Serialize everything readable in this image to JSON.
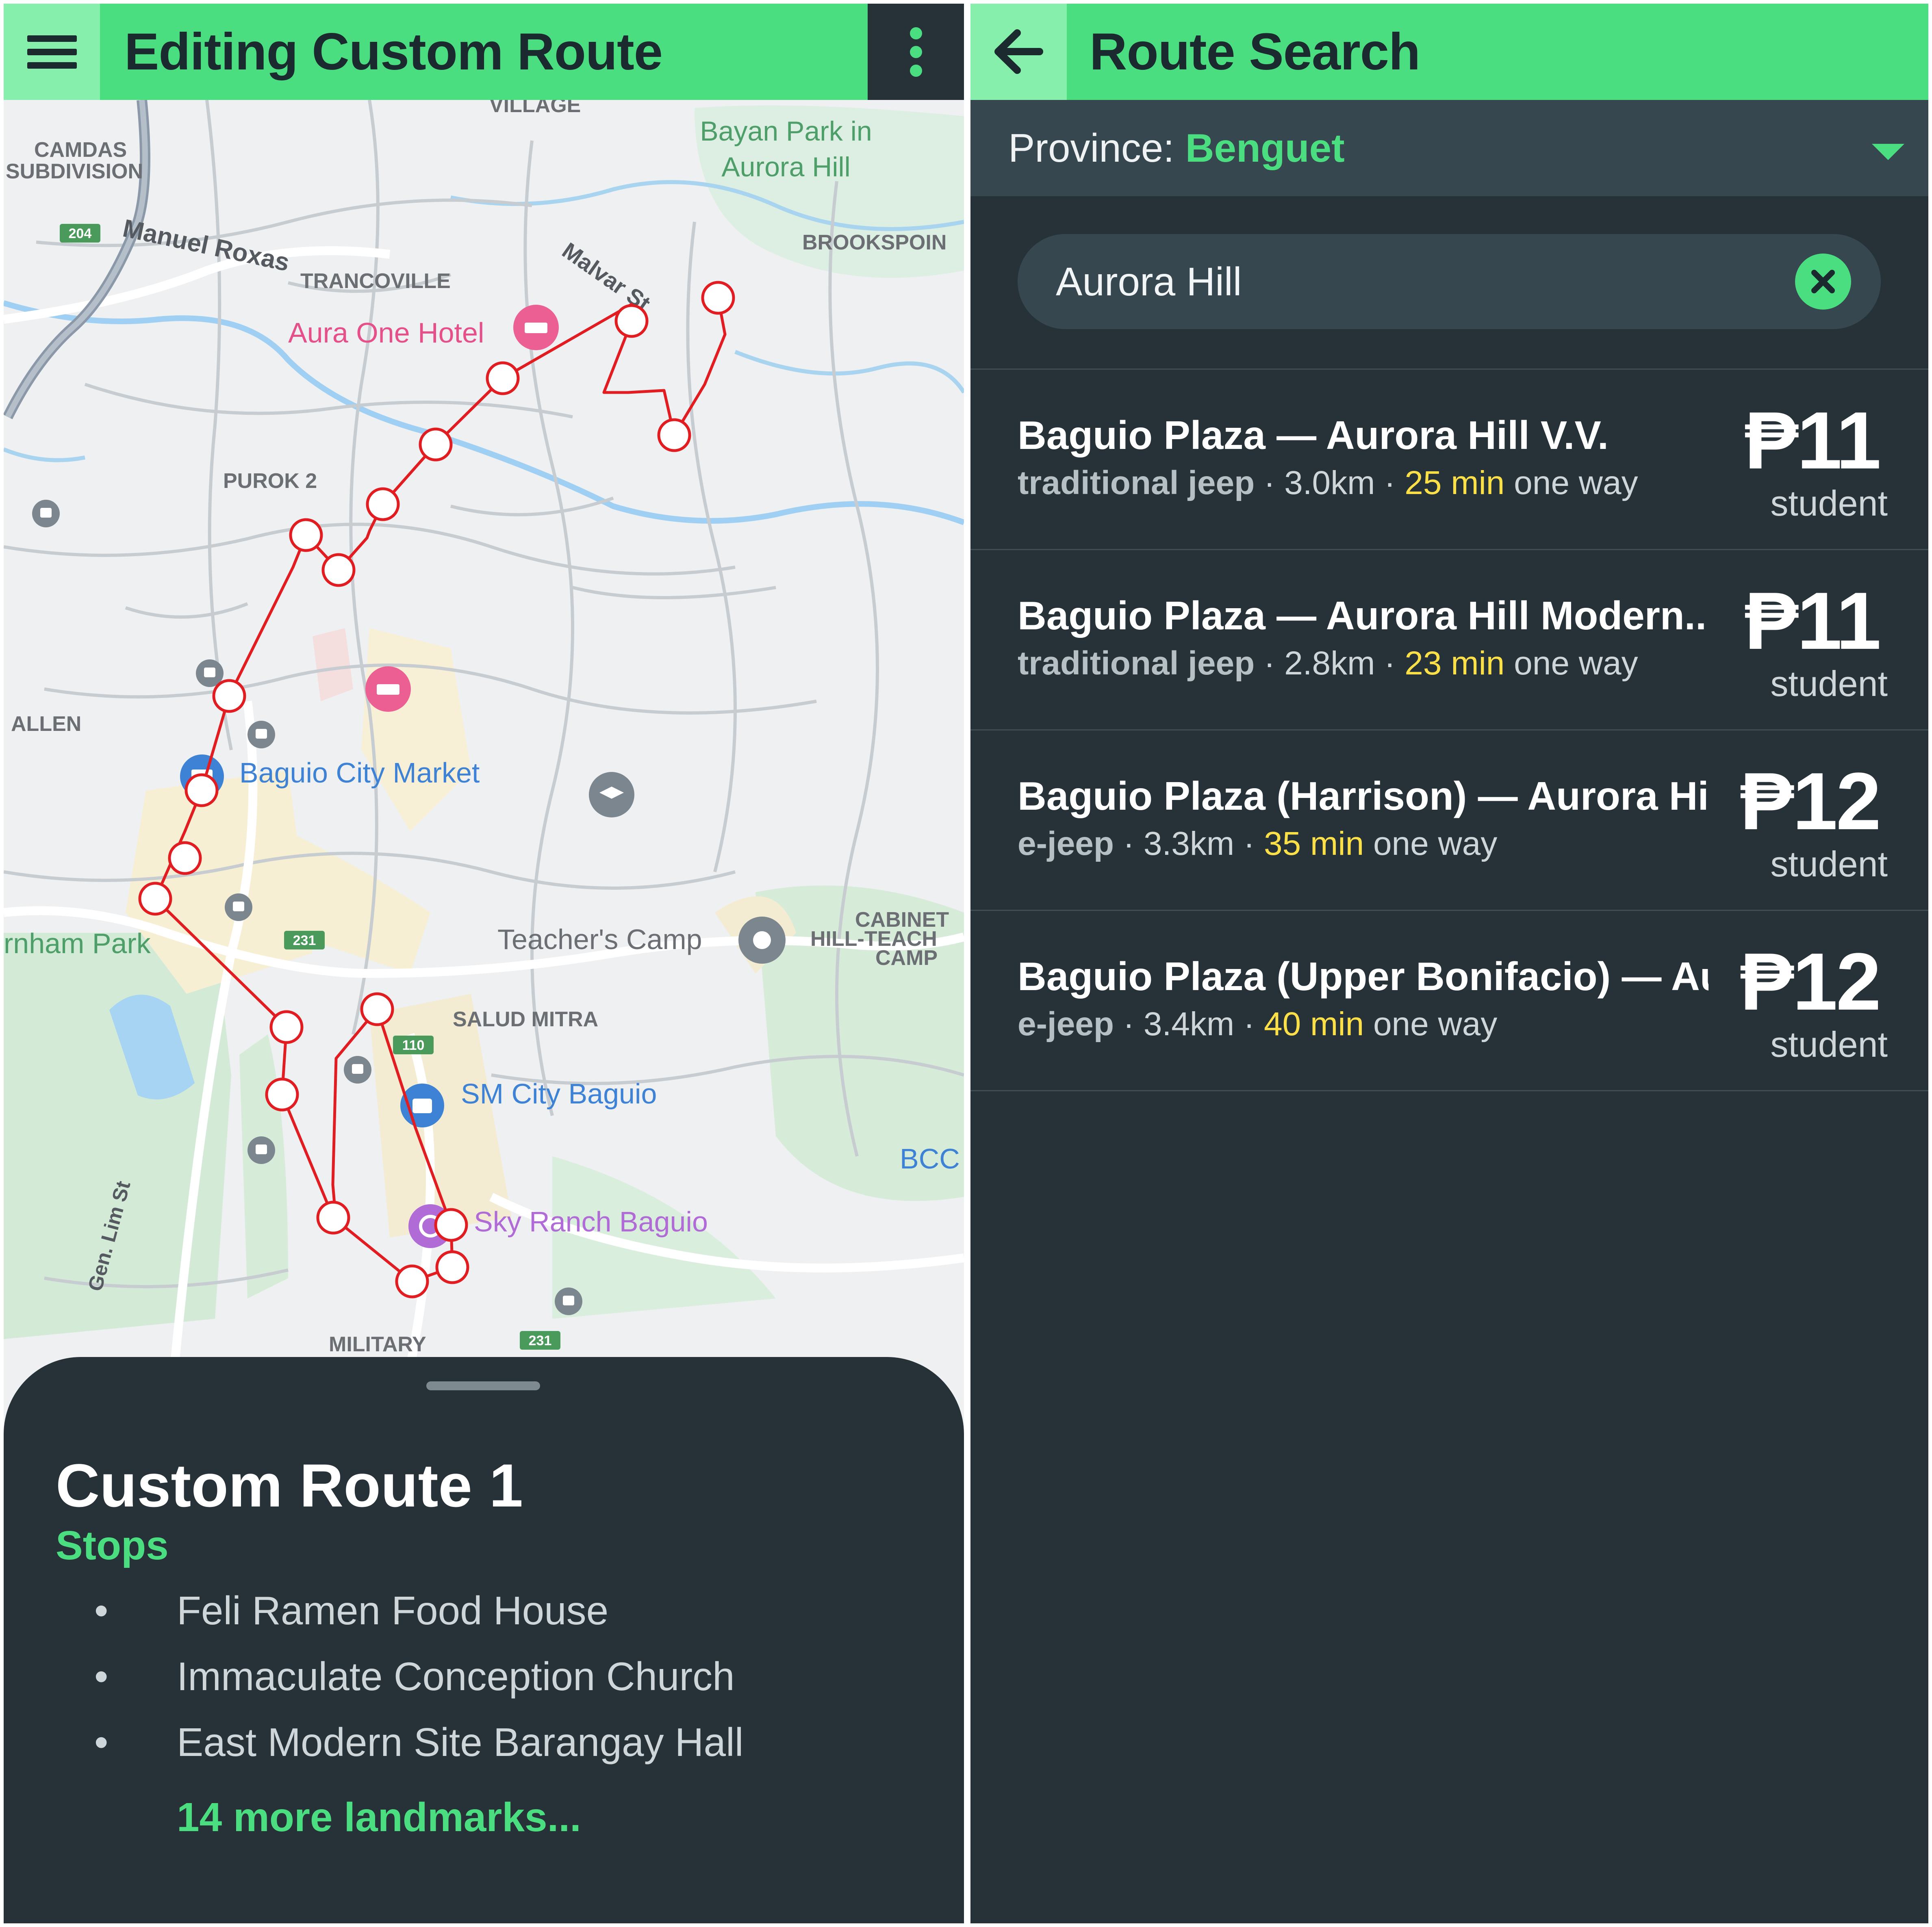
{
  "left_screen": {
    "app_bar": {
      "title": "Editing Custom Route",
      "menu_icon": "hamburger-menu-icon",
      "overflow_icon": "more-vertical-icon",
      "accent_color": "#4ade80"
    },
    "map": {
      "labels": {
        "village": "VILLAGE",
        "camdas": "CAMDAS",
        "subdivision": "SUBDIVISION",
        "bayan_park_line1": "Bayan Park in",
        "bayan_park_line2": "Aurora Hill",
        "manuel_roxas": "Manuel Roxas",
        "malvar": "Malvar St",
        "brookspoint": "BROOKSPOIN",
        "trancoville": "TRANCOVILLE",
        "aura_one_hotel": "Aura One Hotel",
        "purok2": "PUROK 2",
        "allen": "ALLEN",
        "baguio_city_market": "Baguio City Market",
        "burnham_park": "rnham Park",
        "teachers_camp": "Teacher's Camp",
        "cabinet_line1": "CABINET",
        "cabinet_line2": "HILL-TEACH",
        "cabinet_line3": "CAMP",
        "salud_mitra": "SALUD MITRA",
        "sm_city_baguio": "SM City Baguio",
        "bcc": "BCC",
        "sky_ranch": "Sky Ranch Baguio",
        "gen_lim_st": "Gen. Lim St",
        "military": "MILITARY",
        "road_204": "204",
        "road_231a": "231",
        "road_231b": "231",
        "road_110": "110"
      },
      "route_color": "#e11d22"
    },
    "bottom_sheet": {
      "route_name": "Custom Route 1",
      "stops_label": "Stops",
      "stops": [
        "Feli Ramen Food House",
        "Immaculate Conception Church",
        "East Modern Site Barangay Hall"
      ],
      "bullet": "•",
      "more_landmarks": "14 more landmarks..."
    }
  },
  "right_screen": {
    "app_bar": {
      "title": "Route Search",
      "back_icon": "arrow-left-icon"
    },
    "province": {
      "label": "Province: ",
      "value": "Benguet",
      "dropdown_icon": "caret-down-icon"
    },
    "search": {
      "value": "Aurora Hill",
      "clear_icon": "clear-circle-icon"
    },
    "results": [
      {
        "name": "Baguio Plaza — Aurora Hill V.V.",
        "type": "traditional jeep",
        "distance": " · 3.0km · ",
        "time": "25 min",
        "suffix": " one way",
        "fare": "₱11",
        "fare_type": "student"
      },
      {
        "name": "Baguio Plaza — Aurora Hill Modern...",
        "type": "traditional jeep",
        "distance": " · 2.8km · ",
        "time": "23 min",
        "suffix": " one way",
        "fare": "₱11",
        "fare_type": "student"
      },
      {
        "name": "Baguio Plaza (Harrison) — Aurora Hi...",
        "type": "e-jeep",
        "distance": " · 3.3km · ",
        "time": "35 min",
        "suffix": " one way",
        "fare": "₱12",
        "fare_type": "student"
      },
      {
        "name": "Baguio Plaza (Upper Bonifacio) — Au...",
        "type": "e-jeep",
        "distance": " · 3.4km · ",
        "time": "40 min",
        "suffix": " one way",
        "fare": "₱12",
        "fare_type": "student"
      }
    ]
  }
}
